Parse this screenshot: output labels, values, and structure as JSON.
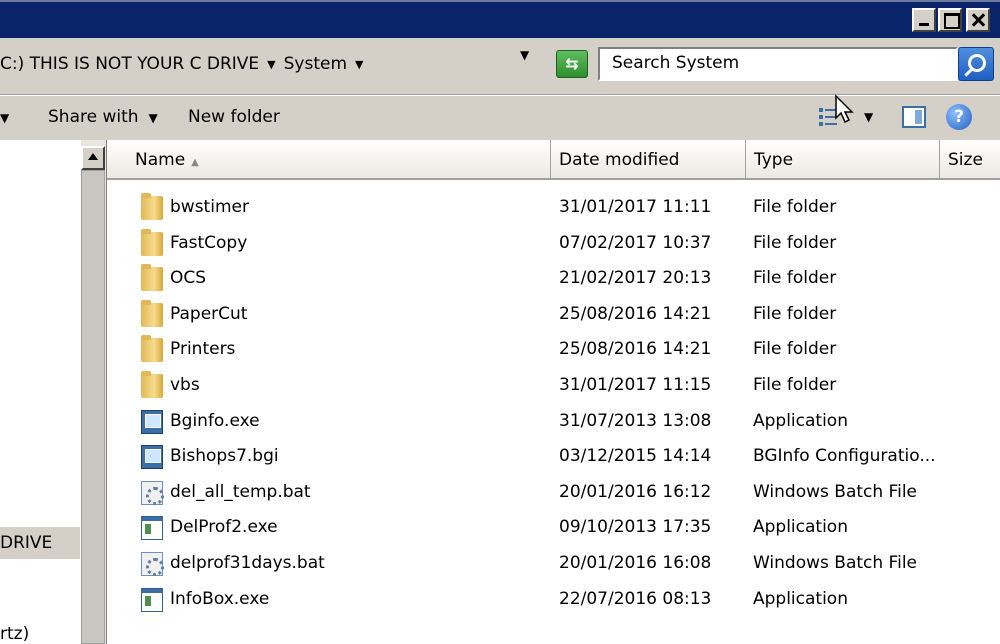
{
  "window": {
    "controls": [
      "minimize",
      "maximize",
      "close"
    ]
  },
  "address": {
    "crumbs": [
      "C:) THIS IS NOT YOUR C DRIVE",
      "System"
    ],
    "refresh_icon": "refresh-icon"
  },
  "search": {
    "placeholder": "Search System"
  },
  "toolbar": {
    "share_label": "Share with",
    "newfolder_label": "New folder"
  },
  "nav": {
    "selected_fragment": "DRIVE",
    "bottom_fragment": "rtz)"
  },
  "columns": [
    "Name",
    "Date modified",
    "Type",
    "Size"
  ],
  "files": [
    {
      "name": "bwstimer",
      "date": "31/01/2017 11:11",
      "type": "File folder",
      "icon": "folder-icon"
    },
    {
      "name": "FastCopy",
      "date": "07/02/2017 10:37",
      "type": "File folder",
      "icon": "folder-icon"
    },
    {
      "name": "OCS",
      "date": "21/02/2017 20:13",
      "type": "File folder",
      "icon": "folder-icon"
    },
    {
      "name": "PaperCut",
      "date": "25/08/2016 14:21",
      "type": "File folder",
      "icon": "folder-icon"
    },
    {
      "name": "Printers",
      "date": "25/08/2016 14:21",
      "type": "File folder",
      "icon": "folder-icon"
    },
    {
      "name": "vbs",
      "date": "31/01/2017 11:15",
      "type": "File folder",
      "icon": "folder-icon"
    },
    {
      "name": "Bginfo.exe",
      "date": "31/07/2013 13:08",
      "type": "Application",
      "icon": "bginfo-icon"
    },
    {
      "name": "Bishops7.bgi",
      "date": "03/12/2015 14:14",
      "type": "BGInfo Configuratio...",
      "icon": "bginfo-icon"
    },
    {
      "name": "del_all_temp.bat",
      "date": "20/01/2016 16:12",
      "type": "Windows Batch File",
      "icon": "batch-icon"
    },
    {
      "name": "DelProf2.exe",
      "date": "09/10/2013 17:35",
      "type": "Application",
      "icon": "exe-icon"
    },
    {
      "name": "delprof31days.bat",
      "date": "20/01/2016 16:08",
      "type": "Windows Batch File",
      "icon": "batch-icon"
    },
    {
      "name": "InfoBox.exe",
      "date": "22/07/2016 08:13",
      "type": "Application",
      "icon": "exe-icon"
    }
  ]
}
